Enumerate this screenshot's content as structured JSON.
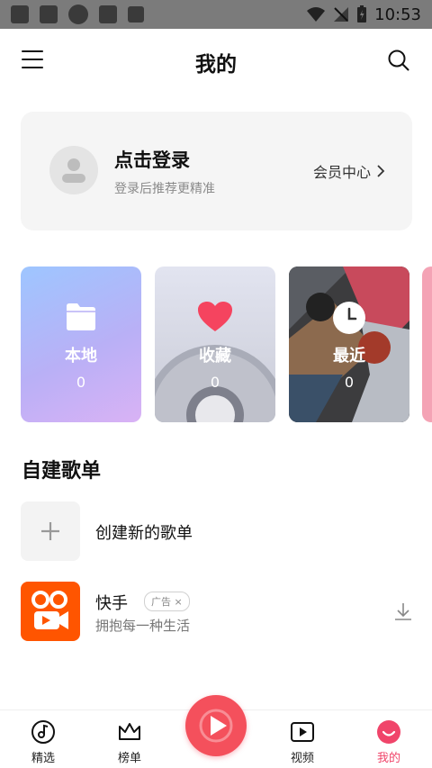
{
  "status_bar": {
    "time": "10:53"
  },
  "header": {
    "title": "我的"
  },
  "login_card": {
    "title": "点击登录",
    "subtitle": "登录后推荐更精准",
    "vip_label": "会员中心"
  },
  "tiles": [
    {
      "label": "本地",
      "count": "0"
    },
    {
      "label": "收藏",
      "count": "0"
    },
    {
      "label": "最近",
      "count": "0"
    }
  ],
  "section": {
    "title": "自建歌单",
    "create_label": "创建新的歌单"
  },
  "ad": {
    "title": "快手",
    "badge": "广告",
    "subtitle": "拥抱每一种生活"
  },
  "nav": {
    "items": [
      {
        "label": "精选"
      },
      {
        "label": "榜单"
      },
      {
        "label": "视频"
      },
      {
        "label": "我的"
      }
    ]
  },
  "colors": {
    "accent": "#f0456a",
    "fab": "#f4505c"
  },
  "icons": [
    "menu-icon",
    "search-icon",
    "user-avatar-icon",
    "folder-icon",
    "heart-icon",
    "clock-icon",
    "plus-icon",
    "download-icon",
    "music-disc-icon",
    "crown-icon",
    "play-icon",
    "video-icon",
    "smile-icon"
  ]
}
